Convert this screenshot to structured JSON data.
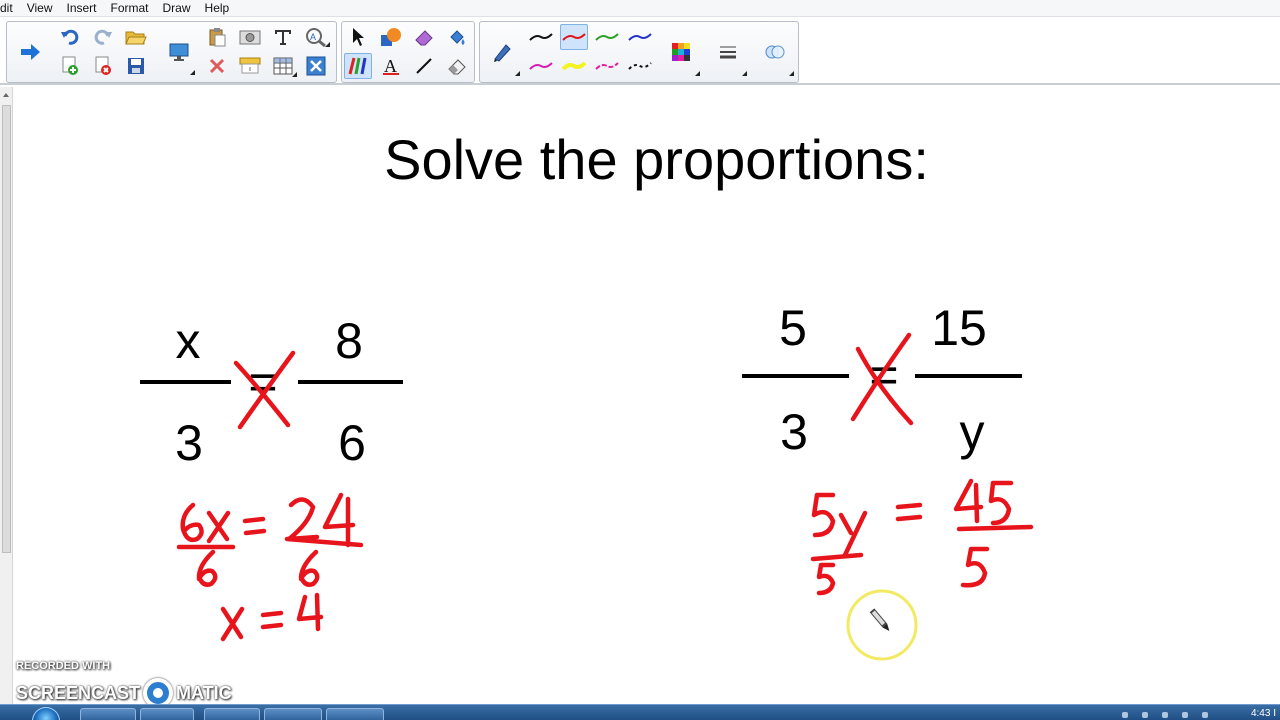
{
  "menu": {
    "items": [
      "dit",
      "View",
      "Insert",
      "Format",
      "Draw",
      "Help"
    ]
  },
  "toolbar": {
    "icons": [
      "next-page-icon",
      "undo-icon",
      "redo-icon",
      "open-file-icon",
      "add-page-icon",
      "delete-page-icon",
      "save-icon",
      "screen-display-icon",
      "paste-icon",
      "screen-capture-icon",
      "text-tool-icon",
      "spell-check-icon",
      "delete-icon",
      "screen-shade-icon",
      "table-icon",
      "close-icon",
      "select-icon",
      "shapes-icon",
      "eraser-icon",
      "fill-icon",
      "creative-pen-icon",
      "text-icon",
      "line-icon",
      "eraser-alt-icon",
      "pen-icon",
      "color-palette-icon",
      "line-properties-icon",
      "magic-pen-icon"
    ],
    "pen_colors": {
      "black": "#111111",
      "red": "#e0141e",
      "green": "#2aa12a",
      "blue": "#2334c8",
      "magenta": "#d21fb7",
      "yellow": "#f3f31f",
      "pink": "#e21f9e",
      "dashed": "#111111"
    }
  },
  "slide": {
    "title": "Solve the proportions:",
    "left_problem": {
      "numerator_left": "x",
      "denominator_left": "3",
      "equals": "=",
      "numerator_right": "8",
      "denominator_right": "6"
    },
    "right_problem": {
      "numerator_left": "5",
      "denominator_left": "3",
      "equals": "=",
      "numerator_right": "15",
      "denominator_right": "y"
    }
  },
  "ink_color": "#e8141c",
  "cursor_highlight_color": "#f2ea63",
  "watermark": {
    "top": "RECORDED WITH",
    "left": "SCREENCAST",
    "right": "MATIC"
  },
  "taskbar": {
    "clock": "4:43 I"
  }
}
